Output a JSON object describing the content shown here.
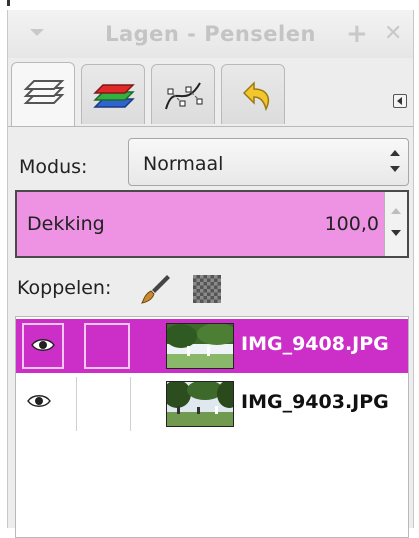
{
  "window": {
    "title": "Lagen - Penselen"
  },
  "tabs": [
    {
      "name": "layers-tab",
      "icon": "layers-icon",
      "active": true
    },
    {
      "name": "channels-tab",
      "icon": "channels-icon",
      "active": false
    },
    {
      "name": "paths-tab",
      "icon": "paths-icon",
      "active": false
    },
    {
      "name": "undo-history-tab",
      "icon": "undo-history-icon",
      "active": false
    }
  ],
  "mode": {
    "label": "Modus:",
    "value": "Normaal"
  },
  "opacity": {
    "label": "Dekking",
    "value": "100,0"
  },
  "lock": {
    "label": "Koppelen:",
    "icons": [
      "lock-pixels-brush-icon",
      "lock-alpha-checker-icon"
    ]
  },
  "layers": [
    {
      "name": "IMG_9408.JPG",
      "selected": true,
      "visible": true
    },
    {
      "name": "IMG_9403.JPG",
      "selected": false,
      "visible": true
    }
  ],
  "colors": {
    "selection": "#cc2fc7",
    "opacity_fill": "#ee93e4",
    "title_text": "#c4c4c4"
  }
}
